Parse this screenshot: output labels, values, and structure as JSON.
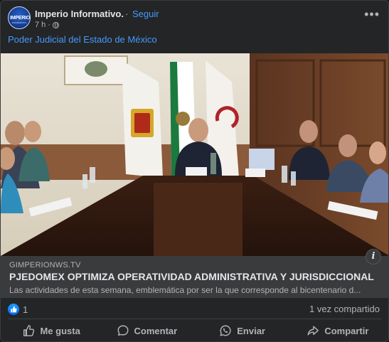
{
  "post": {
    "page_name": "Imperio Informativo.",
    "separator": "·",
    "follow_label": "Seguir",
    "time": "7 h",
    "time_dot": "·",
    "text": "Poder Judicial del Estado de México",
    "avatar_text": "IMPERIO",
    "avatar_subtext": "INFORMATIVO",
    "more_label": "•••"
  },
  "link": {
    "domain": "GIMPERIONWS.TV",
    "headline": "PJEDOMEX OPTIMIZA OPERATIVIDAD ADMINISTRATIVA Y JURISDICCIONAL",
    "description": "Las actividades de esta semana, emblemática por ser la que corresponde al bicentenario d...",
    "info_label": "i"
  },
  "stats": {
    "reactions_count": "1",
    "shares": "1 vez compartido"
  },
  "actions": [
    {
      "label": "Me gusta",
      "icon": "like-icon"
    },
    {
      "label": "Comentar",
      "icon": "comment-icon"
    },
    {
      "label": "Enviar",
      "icon": "whatsapp-icon"
    },
    {
      "label": "Compartir",
      "icon": "share-icon"
    }
  ],
  "colors": {
    "background": "#242526",
    "link_blue": "#4599ff",
    "preview_bg": "#3a3b3c",
    "text_primary": "#e4e6eb",
    "text_secondary": "#b0b3b8",
    "reaction_blue": "#0866ff"
  }
}
